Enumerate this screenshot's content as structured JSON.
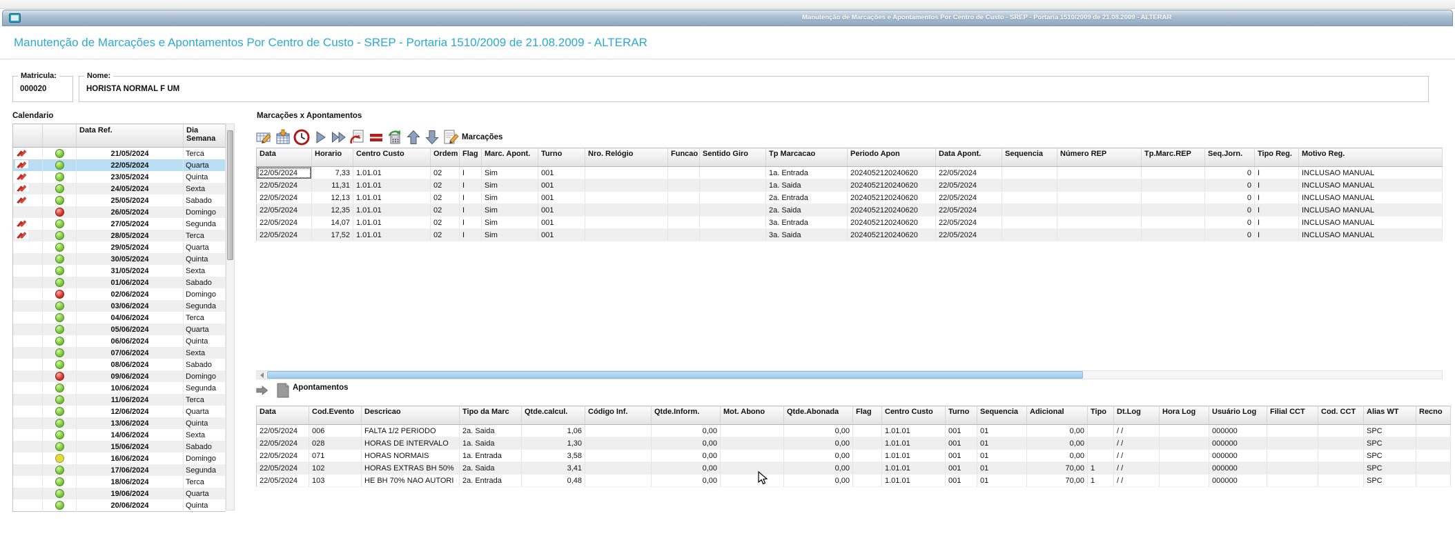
{
  "window": {
    "title": "Manutenção de Marcações e Apontamentos Por Centro de Custo - SREP - Portaria 1510/2009 de 21.08.2009 - ALTERAR"
  },
  "page": {
    "heading": "Manutenção de Marcações e Apontamentos Por Centro de Custo - SREP - Portaria 1510/2009 de 21.08.2009 - ALTERAR"
  },
  "employee": {
    "matricula_label": "Matricula:",
    "matricula_value": "000020",
    "nome_label": "Nome:",
    "nome_value": "HORISTA NORMAL F UM"
  },
  "calendar": {
    "title": "Calendario",
    "columns": [
      "Data Ref.",
      "Dia Semana"
    ],
    "rows": [
      {
        "date": "21/05/2024",
        "day": "Terca",
        "status": "green",
        "edited": true,
        "selected": false
      },
      {
        "date": "22/05/2024",
        "day": "Quarta",
        "status": "green",
        "edited": true,
        "selected": true
      },
      {
        "date": "23/05/2024",
        "day": "Quinta",
        "status": "green",
        "edited": true,
        "selected": false
      },
      {
        "date": "24/05/2024",
        "day": "Sexta",
        "status": "green",
        "edited": true,
        "selected": false
      },
      {
        "date": "25/05/2024",
        "day": "Sabado",
        "status": "green",
        "edited": true,
        "selected": false
      },
      {
        "date": "26/05/2024",
        "day": "Domingo",
        "status": "red",
        "edited": false,
        "selected": false
      },
      {
        "date": "27/05/2024",
        "day": "Segunda",
        "status": "green",
        "edited": true,
        "selected": false
      },
      {
        "date": "28/05/2024",
        "day": "Terca",
        "status": "green",
        "edited": true,
        "selected": false
      },
      {
        "date": "29/05/2024",
        "day": "Quarta",
        "status": "green",
        "edited": false,
        "selected": false
      },
      {
        "date": "30/05/2024",
        "day": "Quinta",
        "status": "green",
        "edited": false,
        "selected": false
      },
      {
        "date": "31/05/2024",
        "day": "Sexta",
        "status": "green",
        "edited": false,
        "selected": false
      },
      {
        "date": "01/06/2024",
        "day": "Sabado",
        "status": "green",
        "edited": false,
        "selected": false
      },
      {
        "date": "02/06/2024",
        "day": "Domingo",
        "status": "red",
        "edited": false,
        "selected": false
      },
      {
        "date": "03/06/2024",
        "day": "Segunda",
        "status": "green",
        "edited": false,
        "selected": false
      },
      {
        "date": "04/06/2024",
        "day": "Terca",
        "status": "green",
        "edited": false,
        "selected": false
      },
      {
        "date": "05/06/2024",
        "day": "Quarta",
        "status": "green",
        "edited": false,
        "selected": false
      },
      {
        "date": "06/06/2024",
        "day": "Quinta",
        "status": "green",
        "edited": false,
        "selected": false
      },
      {
        "date": "07/06/2024",
        "day": "Sexta",
        "status": "green",
        "edited": false,
        "selected": false
      },
      {
        "date": "08/06/2024",
        "day": "Sabado",
        "status": "green",
        "edited": false,
        "selected": false
      },
      {
        "date": "09/06/2024",
        "day": "Domingo",
        "status": "red",
        "edited": false,
        "selected": false
      },
      {
        "date": "10/06/2024",
        "day": "Segunda",
        "status": "green",
        "edited": false,
        "selected": false
      },
      {
        "date": "11/06/2024",
        "day": "Terca",
        "status": "green",
        "edited": false,
        "selected": false
      },
      {
        "date": "12/06/2024",
        "day": "Quarta",
        "status": "green",
        "edited": false,
        "selected": false
      },
      {
        "date": "13/06/2024",
        "day": "Quinta",
        "status": "green",
        "edited": false,
        "selected": false
      },
      {
        "date": "14/06/2024",
        "day": "Sexta",
        "status": "green",
        "edited": false,
        "selected": false
      },
      {
        "date": "15/06/2024",
        "day": "Sabado",
        "status": "green",
        "edited": false,
        "selected": false
      },
      {
        "date": "16/06/2024",
        "day": "Domingo",
        "status": "yellow",
        "edited": false,
        "selected": false
      },
      {
        "date": "17/06/2024",
        "day": "Segunda",
        "status": "green",
        "edited": false,
        "selected": false
      },
      {
        "date": "18/06/2024",
        "day": "Terca",
        "status": "green",
        "edited": false,
        "selected": false
      },
      {
        "date": "19/06/2024",
        "day": "Quarta",
        "status": "green",
        "edited": false,
        "selected": false
      },
      {
        "date": "20/06/2024",
        "day": "Quinta",
        "status": "green",
        "edited": false,
        "selected": false
      }
    ]
  },
  "marcacoes": {
    "section_title": "Marcações x Apontamentos",
    "grid_title": "Marcações",
    "toolbar": [
      "edit-cell",
      "insert-calendar",
      "clock",
      "play",
      "fast-forward",
      "revert-document",
      "equals",
      "recalculate",
      "arrow-up",
      "arrow-down",
      "edit-document"
    ],
    "columns": [
      "Data",
      "Horario",
      "Centro Custo",
      "Ordem",
      "Flag",
      "Marc. Apont.",
      "Turno",
      "Nro. Relógio",
      "Funcao",
      "Sentido Giro",
      "Tp Marcacao",
      "Periodo Apon",
      "Data Apont.",
      "Sequencia",
      "Número REP",
      "Tp.Marc.REP",
      "Seq.Jorn.",
      "Tipo Reg.",
      "Motivo Reg."
    ],
    "rows": [
      [
        "22/05/2024",
        "7,33",
        "1.01.01",
        "02",
        "I",
        "Sim",
        "001",
        "",
        "",
        "",
        "1a. Entrada",
        "2024052120240620",
        "22/05/2024",
        "",
        "",
        "",
        "0",
        "I",
        "INCLUSAO MANUAL"
      ],
      [
        "22/05/2024",
        "11,31",
        "1.01.01",
        "02",
        "I",
        "Sim",
        "001",
        "",
        "",
        "",
        "1a. Saida",
        "2024052120240620",
        "22/05/2024",
        "",
        "",
        "",
        "0",
        "I",
        "INCLUSAO MANUAL"
      ],
      [
        "22/05/2024",
        "12,13",
        "1.01.01",
        "02",
        "I",
        "Sim",
        "001",
        "",
        "",
        "",
        "2a. Entrada",
        "2024052120240620",
        "22/05/2024",
        "",
        "",
        "",
        "0",
        "I",
        "INCLUSAO MANUAL"
      ],
      [
        "22/05/2024",
        "12,35",
        "1.01.01",
        "02",
        "I",
        "Sim",
        "001",
        "",
        "",
        "",
        "2a. Saida",
        "2024052120240620",
        "22/05/2024",
        "",
        "",
        "",
        "0",
        "I",
        "INCLUSAO MANUAL"
      ],
      [
        "22/05/2024",
        "14,07",
        "1.01.01",
        "02",
        "I",
        "Sim",
        "001",
        "",
        "",
        "",
        "3a. Entrada",
        "2024052120240620",
        "22/05/2024",
        "",
        "",
        "",
        "0",
        "I",
        "INCLUSAO MANUAL"
      ],
      [
        "22/05/2024",
        "17,52",
        "1.01.01",
        "02",
        "I",
        "Sim",
        "001",
        "",
        "",
        "",
        "3a. Saida",
        "2024052120240620",
        "22/05/2024",
        "",
        "",
        "",
        "0",
        "I",
        "INCLUSAO MANUAL"
      ]
    ]
  },
  "apontamentos": {
    "grid_title": "Apontamentos",
    "toolbar": [
      "forward",
      "document"
    ],
    "columns": [
      "Data",
      "Cod.Evento",
      "Descricao",
      "Tipo da Marc",
      "Qtde.calcul.",
      "Código Inf.",
      "Qtde.Inform.",
      "Mot. Abono",
      "Qtde.Abonada",
      "Flag",
      "Centro Custo",
      "Turno",
      "Sequencia",
      "Adicional",
      "Tipo",
      "Dt.Log",
      "Hora Log",
      "Usuário Log",
      "Filial CCT",
      "Cod. CCT",
      "Alias WT",
      "Recno"
    ],
    "rows": [
      [
        "22/05/2024",
        "006",
        "FALTA 1/2 PERIODO",
        "2a. Saida",
        "1,06",
        "",
        "0,00",
        "",
        "0,00",
        "",
        "1.01.01",
        "001",
        "01",
        "0,00",
        "",
        "/ /",
        "",
        "000000",
        "",
        "",
        "SPC",
        ""
      ],
      [
        "22/05/2024",
        "028",
        "HORAS DE INTERVALO",
        "1a. Saida",
        "1,30",
        "",
        "0,00",
        "",
        "0,00",
        "",
        "1.01.01",
        "001",
        "01",
        "0,00",
        "",
        "/ /",
        "",
        "000000",
        "",
        "",
        "SPC",
        ""
      ],
      [
        "22/05/2024",
        "071",
        "HORAS NORMAIS",
        "1a. Entrada",
        "3,58",
        "",
        "0,00",
        "",
        "0,00",
        "",
        "1.01.01",
        "001",
        "01",
        "0,00",
        "",
        "/ /",
        "",
        "000000",
        "",
        "",
        "SPC",
        ""
      ],
      [
        "22/05/2024",
        "102",
        "HORAS EXTRAS BH 50%",
        "2a. Saida",
        "3,41",
        "",
        "0,00",
        "",
        "0,00",
        "",
        "1.01.01",
        "001",
        "01",
        "70,00",
        "1",
        "/ /",
        "",
        "000000",
        "",
        "",
        "SPC",
        ""
      ],
      [
        "22/05/2024",
        "103",
        "HE BH 70% NAO AUTORI",
        "2a. Entrada",
        "0,48",
        "",
        "0,00",
        "",
        "0,00",
        "",
        "1.01.01",
        "001",
        "01",
        "70,00",
        "1",
        "/ /",
        "",
        "000000",
        "",
        "",
        "SPC",
        ""
      ]
    ]
  },
  "colors": {
    "heading": "#2baad2",
    "titlebar_text": "#ffffff",
    "selected_row": "#b9ddf3",
    "status_green": "#7ecc3e",
    "status_red": "#dc3b33",
    "status_yellow": "#e3da40",
    "scrollbar_thumb": "#9ccbed"
  }
}
